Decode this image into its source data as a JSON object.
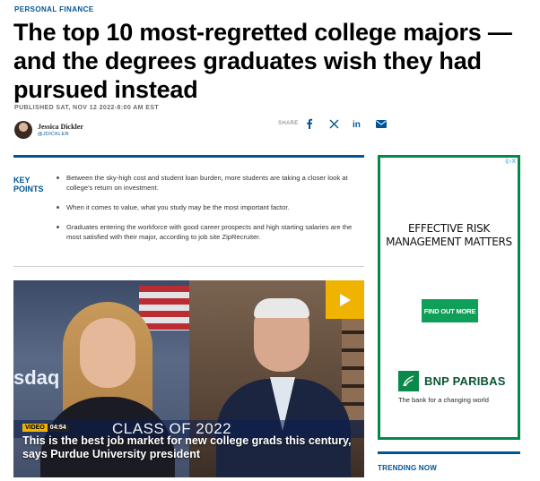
{
  "article": {
    "section": "PERSONAL FINANCE",
    "headline": "The top 10 most-regretted college majors — and the degrees graduates wish they had pursued instead",
    "published": "PUBLISHED SAT, NOV 12 2022-8:00 AM EST",
    "author": {
      "name": "Jessica Dickler",
      "handle": "@JDICKLER"
    }
  },
  "share": {
    "label": "SHARE",
    "icons": [
      "facebook-icon",
      "x-icon",
      "linkedin-icon",
      "email-icon"
    ]
  },
  "key_points": {
    "title": "KEY POINTS",
    "items": [
      "Between the sky-high cost and student loan burden, more students are taking a closer look at college's return on investment.",
      "When it comes to value, what you study may be the most important factor.",
      "Graduates entering the workforce with good career prospects and high starting salaries are the most satisfied with their major, according to job site ZipRecruiter."
    ]
  },
  "video": {
    "tag": "VIDEO",
    "duration": "04:54",
    "banner_text": "CLASS OF 2022",
    "background_text": "sdaq",
    "title": "This is the best job market for new college grads this century, says Purdue University president"
  },
  "ad": {
    "badge": "i▷X",
    "headline": "EFFECTIVE RISK MANAGEMENT MATTERS",
    "button": "FIND OUT MORE",
    "brand": "BNP PARIBAS",
    "tagline": "The bank for a changing world"
  },
  "sidebar": {
    "trending_label": "TRENDING NOW"
  },
  "colors": {
    "accent": "#005594",
    "video_tag": "#f0b400",
    "ad_green": "#008a45"
  }
}
